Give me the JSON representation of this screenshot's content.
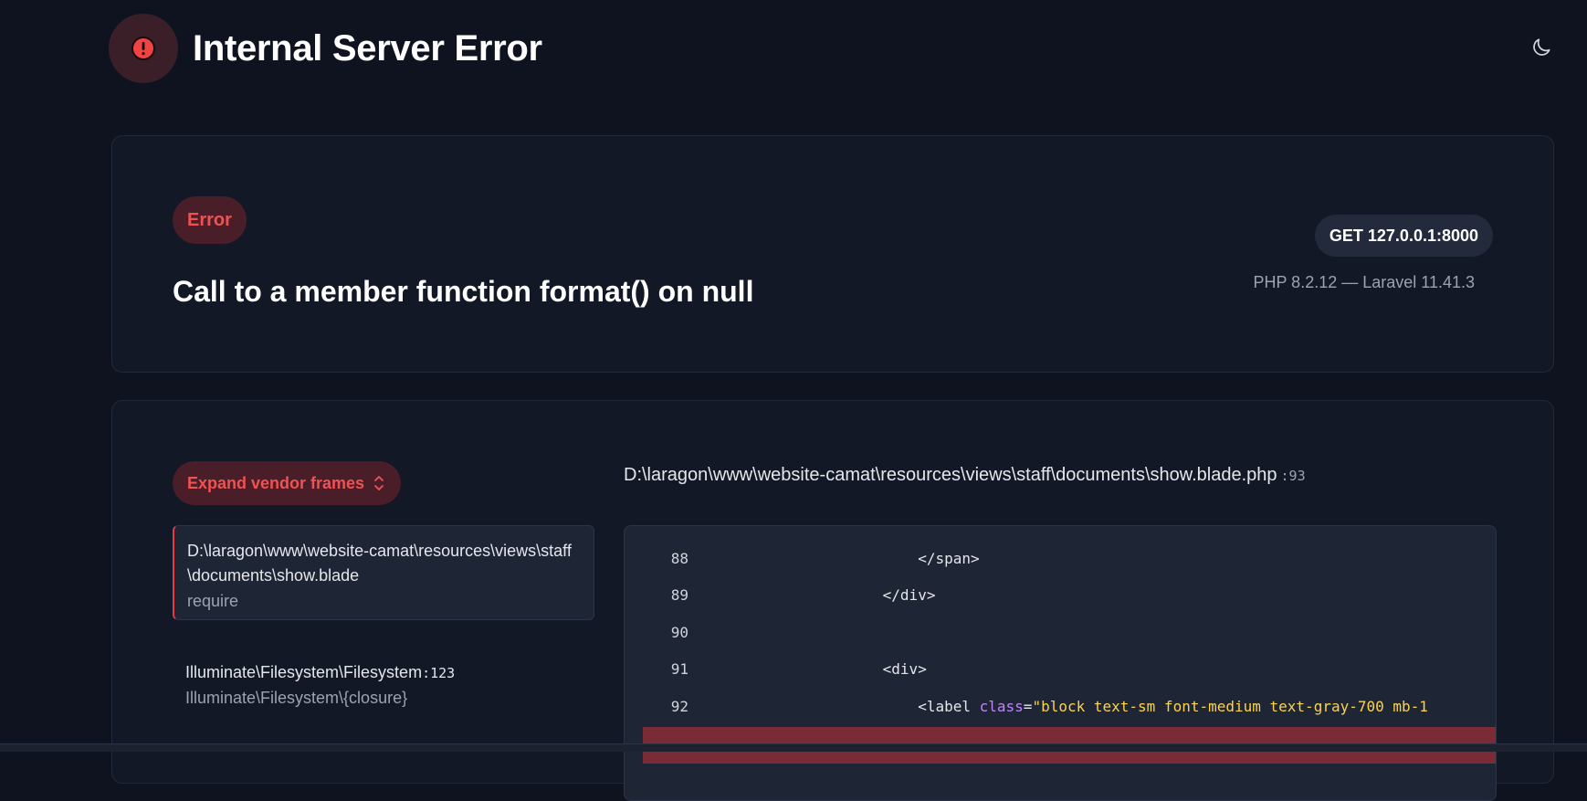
{
  "header": {
    "title": "Internal Server Error",
    "icon": "alert-circle-icon",
    "theme_icon": "moon-icon"
  },
  "exception": {
    "badge": "Error",
    "message": "Call to a member function format() on null",
    "request": "GET 127.0.0.1:8000",
    "versions": "PHP 8.2.12 — Laravel 11.41.3"
  },
  "trace": {
    "expand_label": "Expand vendor frames",
    "frames": [
      {
        "file": "D:\\laragon\\www\\website-camat\\resources\\views\\staff\\documents\\show.blade",
        "line": "",
        "function": "require"
      },
      {
        "file": "Illuminate\\Filesystem\\Filesystem",
        "line": ":123",
        "function": "Illuminate\\Filesystem\\{closure}"
      }
    ]
  },
  "code": {
    "path": "D:\\laragon\\www\\website-camat\\resources\\views\\staff\\documents\\show.blade.php",
    "line_ref": ":93",
    "lines": [
      {
        "num": "88",
        "indent": "                        ",
        "text": "</span>"
      },
      {
        "num": "89",
        "indent": "                    ",
        "text": "</div>"
      },
      {
        "num": "90",
        "indent": "",
        "text": ""
      },
      {
        "num": "91",
        "indent": "                    ",
        "text": "<div>"
      },
      {
        "num": "92",
        "indent": "                        ",
        "pre": "<label ",
        "attr": "class",
        "eq": "=",
        "str": "\"block text-sm font-medium text-gray-700 mb-1"
      }
    ]
  },
  "colors": {
    "accent_red": "#f05252",
    "badge_bg": "#4a1e28",
    "highlight_line": "#7a2b35"
  }
}
